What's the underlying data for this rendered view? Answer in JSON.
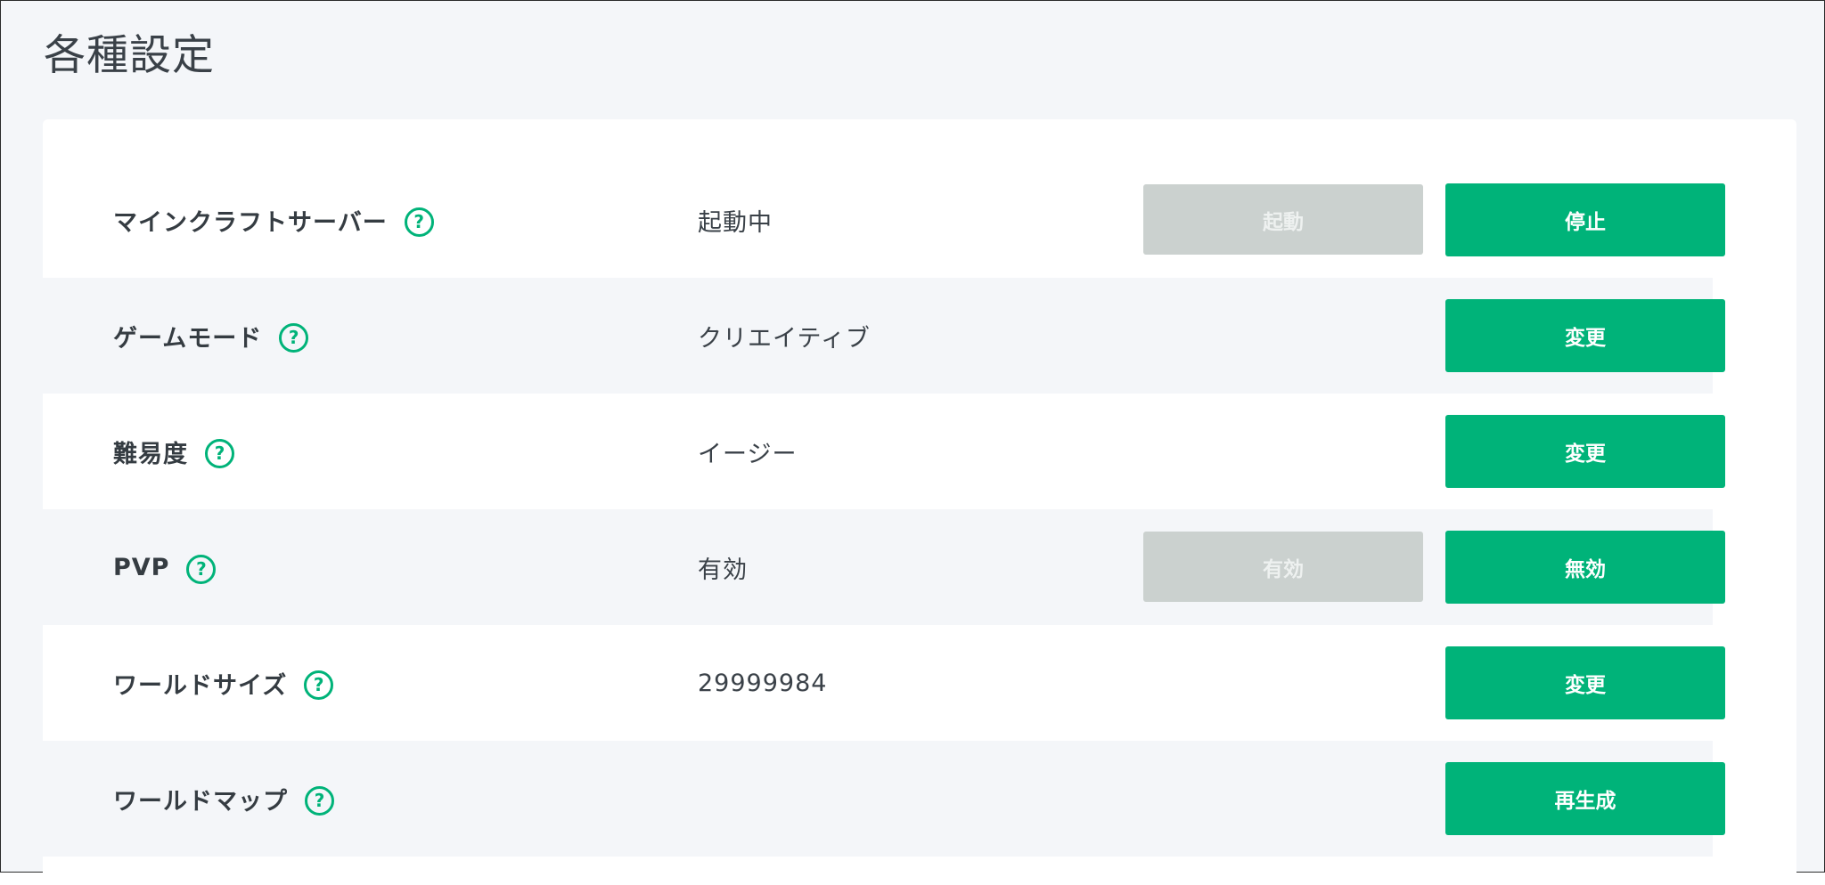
{
  "page": {
    "title": "各種設定"
  },
  "settings": [
    {
      "label": "マインクラフトサーバー",
      "value": "起動中",
      "secondary_button": "起動",
      "primary_button": "停止"
    },
    {
      "label": "ゲームモード",
      "value": "クリエイティブ",
      "primary_button": "変更"
    },
    {
      "label": "難易度",
      "value": "イージー",
      "primary_button": "変更"
    },
    {
      "label": "PVP",
      "value": "有効",
      "secondary_button": "有効",
      "primary_button": "無効"
    },
    {
      "label": "ワールドサイズ",
      "value": "29999984",
      "primary_button": "変更"
    },
    {
      "label": "ワールドマップ",
      "value": "",
      "primary_button": "再生成"
    }
  ],
  "help_icon_glyph": "?",
  "colors": {
    "accent": "#00b379",
    "disabled_button": "#cbd1cf",
    "row_shade": "#f4f6f9"
  }
}
